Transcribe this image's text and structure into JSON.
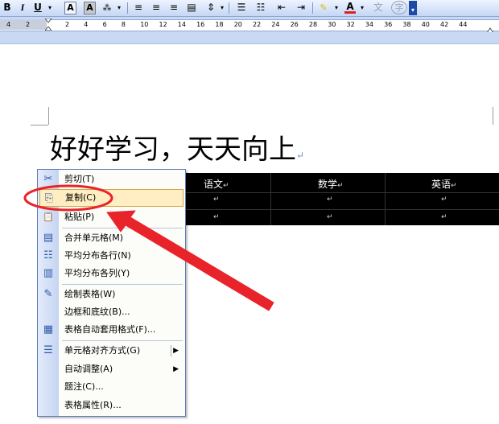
{
  "toolbar": {
    "bold": "B",
    "italic": "I",
    "underline": "U",
    "dropdown_glyph": "▾",
    "font_color_letter": "A",
    "char_shade_letter": "A",
    "phonetic_label": "文",
    "enclose_char": "字"
  },
  "ruler": {
    "numbers": [
      "4",
      "2",
      "2",
      "4",
      "6",
      "8",
      "10",
      "12",
      "14",
      "16",
      "18",
      "20",
      "22",
      "24",
      "26",
      "28",
      "30",
      "32",
      "34",
      "36",
      "38",
      "40",
      "42",
      "44"
    ]
  },
  "document": {
    "heading": "好好学习，天天向上",
    "paragraph_mark": "↵"
  },
  "table": {
    "headers": [
      "语文",
      "数学",
      "英语"
    ],
    "cell_mark": "↵"
  },
  "menu": {
    "items": [
      {
        "icon": "✂",
        "label": "剪切(T)"
      },
      {
        "icon": "⎘",
        "label": "复制(C)"
      },
      {
        "icon": "📋",
        "label": "粘贴(P)"
      },
      {
        "icon": "▤",
        "label": "合并单元格(M)"
      },
      {
        "icon": "☷",
        "label": "平均分布各行(N)"
      },
      {
        "icon": "▥",
        "label": "平均分布各列(Y)"
      },
      {
        "icon": "✎",
        "label": "绘制表格(W)"
      },
      {
        "icon": "",
        "label": "边框和底纹(B)..."
      },
      {
        "icon": "▦",
        "label": "表格自动套用格式(F)..."
      },
      {
        "icon": "☰",
        "label": "单元格对齐方式(G)",
        "arrow": "▶"
      },
      {
        "icon": "",
        "label": "自动调整(A)",
        "arrow": "▶"
      },
      {
        "icon": "",
        "label": "题注(C)..."
      },
      {
        "icon": "",
        "label": "表格属性(R)..."
      }
    ]
  },
  "colors": {
    "annotation": "#e8242a",
    "menu_highlight": "#ffeec2",
    "table_bg": "#000000"
  }
}
